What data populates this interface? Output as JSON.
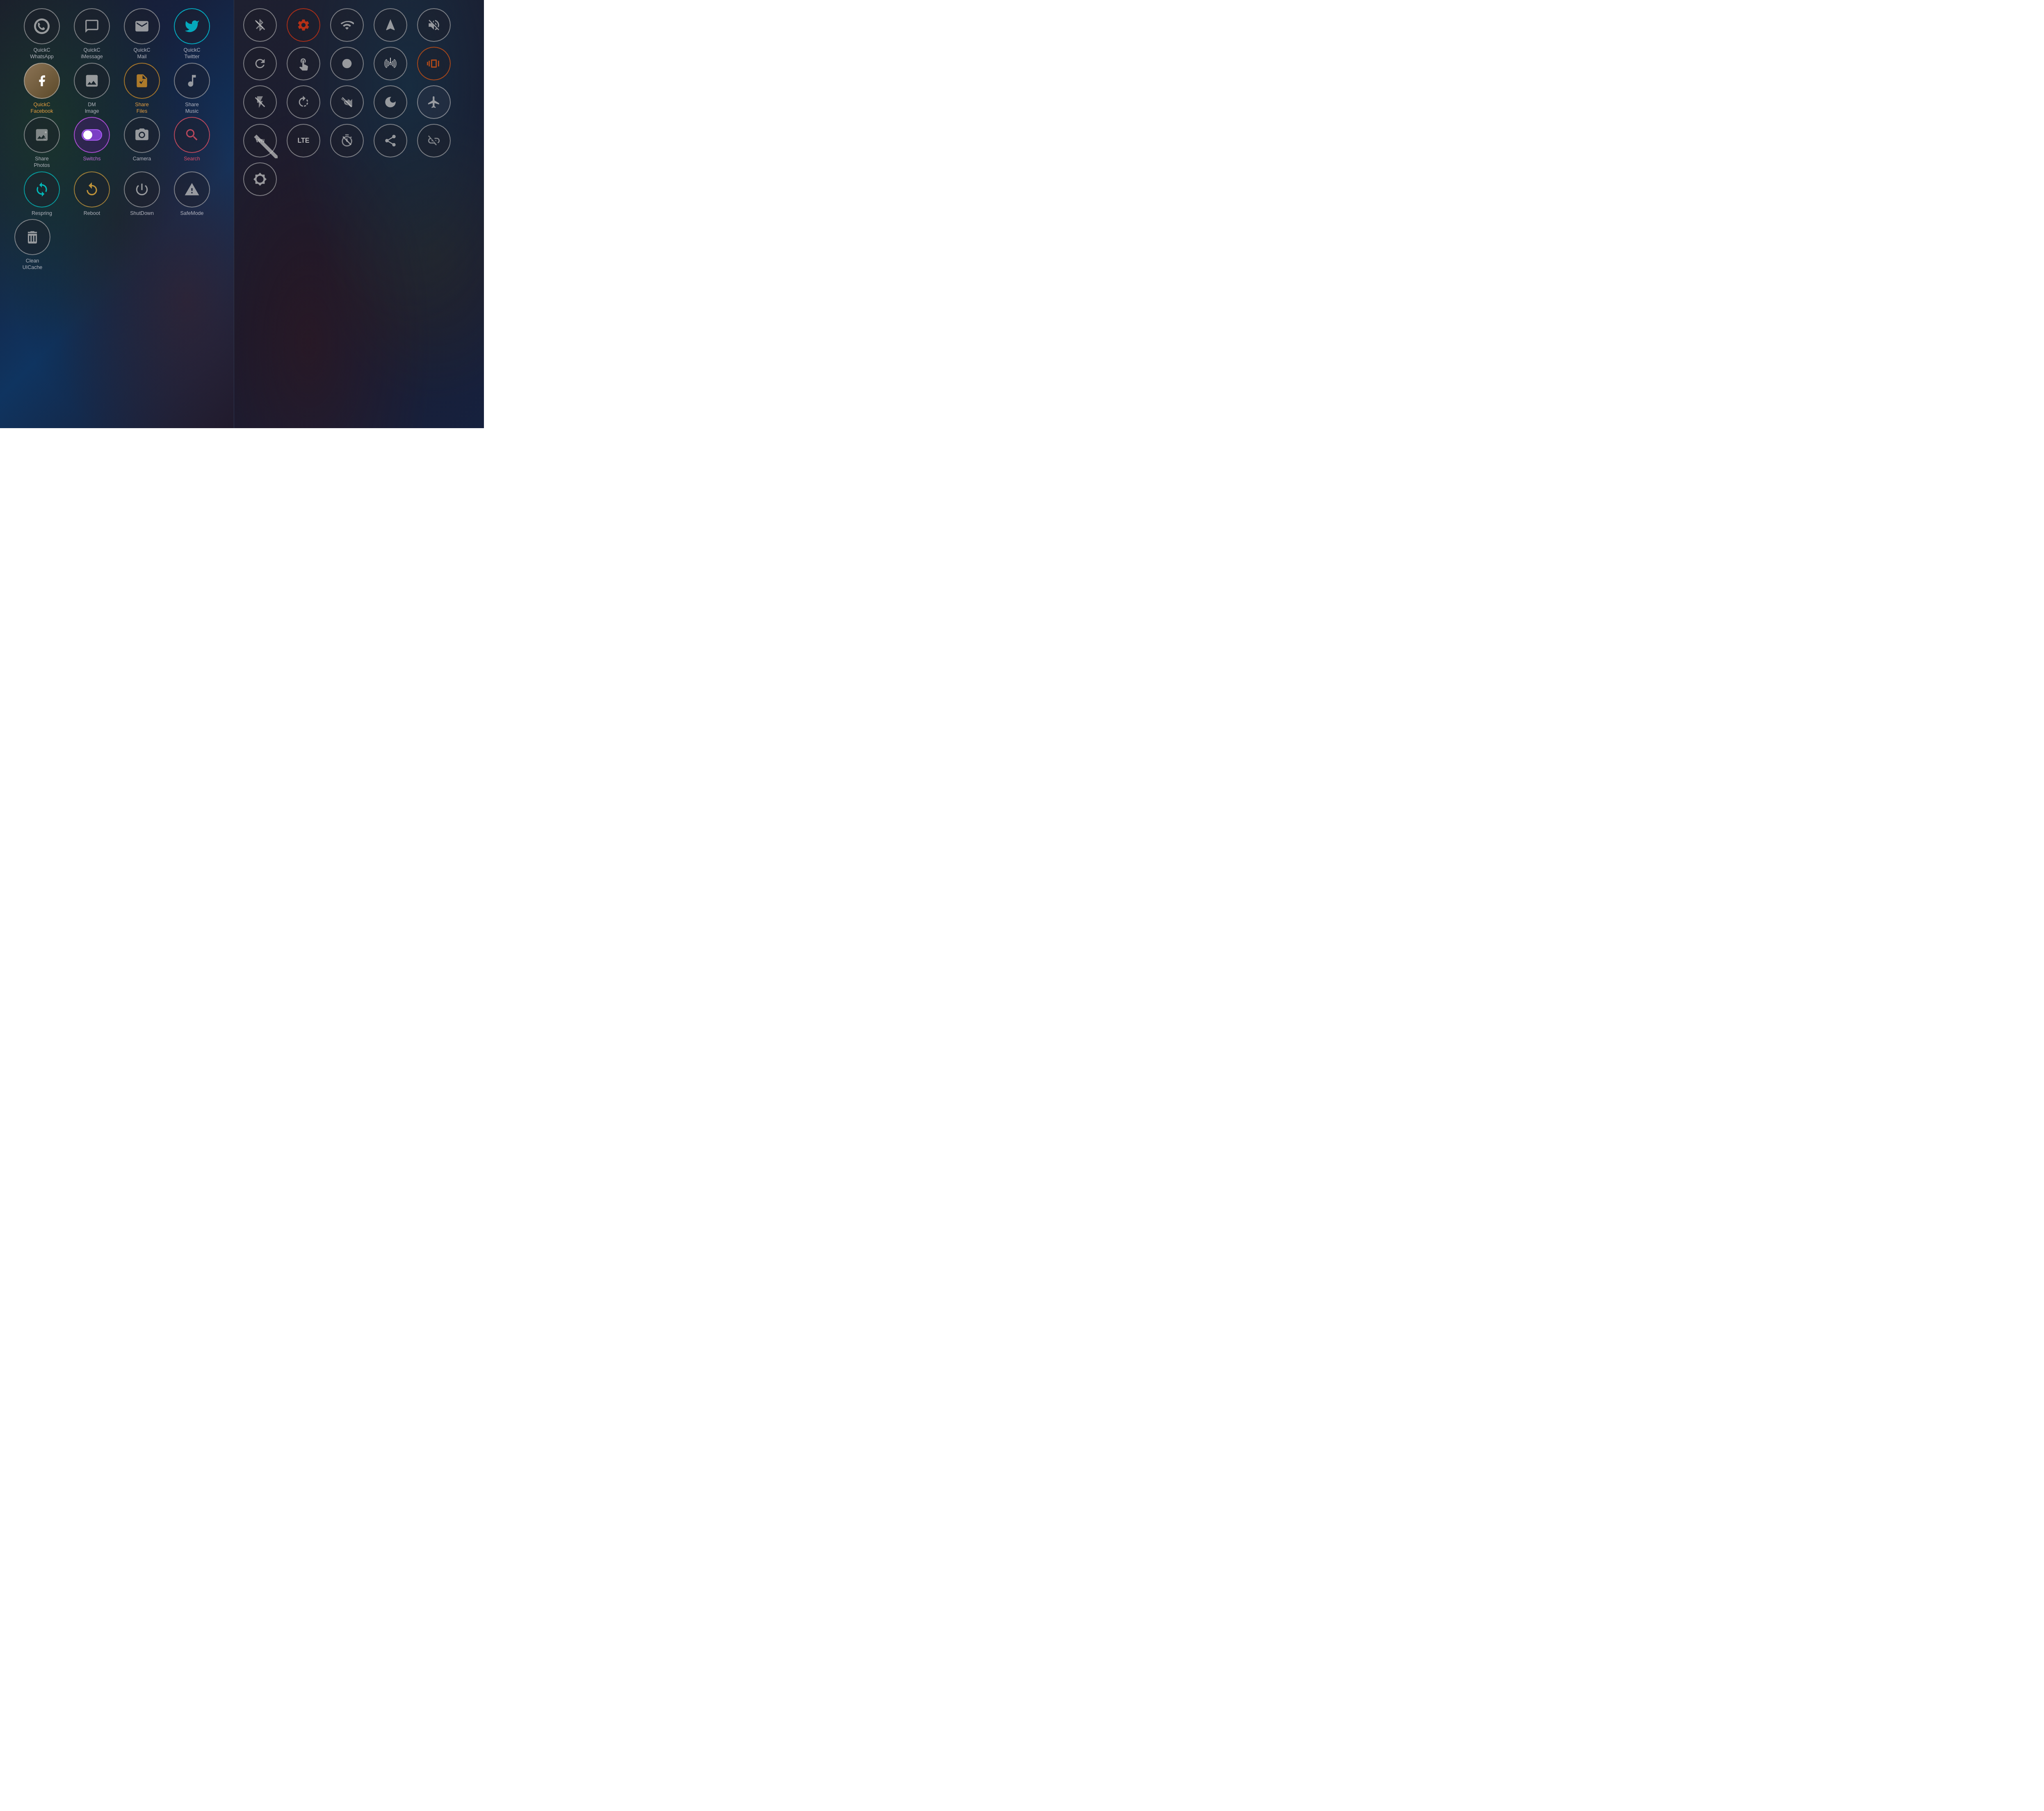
{
  "left": {
    "rows": [
      [
        {
          "id": "quickc-whatsapp",
          "label": "QuickC\nWhatsApp",
          "icon": "chat",
          "labelClass": ""
        },
        {
          "id": "quickc-imessage",
          "label": "QuickC\niMessage",
          "icon": "bubble",
          "labelClass": ""
        },
        {
          "id": "quickc-mail",
          "label": "QuickC\nMail",
          "icon": "mail",
          "labelClass": ""
        },
        {
          "id": "quickc-twitter",
          "label": "QuickC\nTwitter",
          "icon": "twitter",
          "labelClass": "",
          "borderColor": "teal"
        }
      ],
      [
        {
          "id": "quickc-facebook",
          "label": "QuickC\nFacebook",
          "icon": "facebook",
          "labelClass": "label-orange",
          "special": "facebook"
        },
        {
          "id": "dm-image",
          "label": "DM\nImage",
          "icon": "image",
          "labelClass": ""
        },
        {
          "id": "share-files",
          "label": "Share\nFiles",
          "icon": "sharefiles",
          "labelClass": "label-orange"
        },
        {
          "id": "share-music",
          "label": "Share\nMusic",
          "icon": "music",
          "labelClass": ""
        }
      ],
      [
        {
          "id": "share-photos",
          "label": "Share\nPhotos",
          "icon": "photos",
          "labelClass": ""
        },
        {
          "id": "switchs",
          "label": "Switchs",
          "icon": "toggle",
          "labelClass": "label-purple",
          "special": "toggle"
        },
        {
          "id": "camera",
          "label": "Camera",
          "icon": "camera",
          "labelClass": ""
        },
        {
          "id": "search",
          "label": "Search",
          "icon": "search",
          "labelClass": "label-pink",
          "special": "pink"
        }
      ],
      [
        {
          "id": "respring",
          "label": "Respring",
          "icon": "respring",
          "labelClass": "",
          "special": "teal"
        },
        {
          "id": "reboot",
          "label": "Reboot",
          "icon": "reboot",
          "labelClass": "",
          "special": "reboot"
        },
        {
          "id": "shutdown",
          "label": "ShutDown",
          "icon": "power",
          "labelClass": ""
        },
        {
          "id": "safemode",
          "label": "SafeMode",
          "icon": "warning",
          "labelClass": ""
        }
      ],
      [
        {
          "id": "clean-uicache",
          "label": "Clean\nUICache",
          "icon": "trash",
          "labelClass": ""
        }
      ]
    ]
  },
  "right": {
    "rows": [
      [
        {
          "id": "bluetooth",
          "icon": "bluetooth",
          "special": ""
        },
        {
          "id": "settings",
          "icon": "gear",
          "special": "red"
        },
        {
          "id": "wifi",
          "icon": "wifi",
          "special": ""
        },
        {
          "id": "location",
          "icon": "location",
          "special": ""
        },
        {
          "id": "mute",
          "icon": "mute",
          "special": ""
        }
      ],
      [
        {
          "id": "refresh",
          "icon": "refresh2",
          "special": ""
        },
        {
          "id": "touch",
          "icon": "touch",
          "special": ""
        },
        {
          "id": "record",
          "icon": "record",
          "special": ""
        },
        {
          "id": "antenna",
          "icon": "antenna",
          "special": ""
        },
        {
          "id": "vibrate",
          "icon": "vibrate",
          "special": "orange-border"
        }
      ],
      [
        {
          "id": "flashlight",
          "icon": "flashlight",
          "special": ""
        },
        {
          "id": "rotate",
          "icon": "rotate",
          "special": ""
        },
        {
          "id": "camera-off",
          "icon": "camera-off",
          "special": ""
        },
        {
          "id": "moon",
          "icon": "moon",
          "special": ""
        },
        {
          "id": "airplane",
          "icon": "airplane",
          "special": ""
        }
      ],
      [
        {
          "id": "vpn",
          "icon": "vpn",
          "special": ""
        },
        {
          "id": "lte",
          "icon": "lte",
          "special": ""
        },
        {
          "id": "timer-off",
          "icon": "timer-off",
          "special": ""
        },
        {
          "id": "share",
          "icon": "share",
          "special": ""
        },
        {
          "id": "link-off",
          "icon": "link-off",
          "special": ""
        }
      ],
      [
        {
          "id": "brightness",
          "icon": "brightness",
          "special": ""
        }
      ]
    ]
  }
}
